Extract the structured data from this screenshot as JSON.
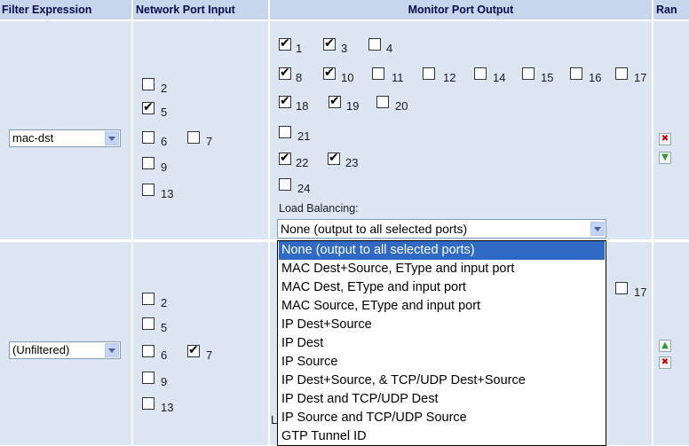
{
  "headers": {
    "filter": "Filter Expression",
    "input": "Network Port Input",
    "output": "Monitor Port Output",
    "rank": "Ran"
  },
  "row1": {
    "filter_value": "mac-dst",
    "input_ports": [
      {
        "label": "2",
        "checked": false
      },
      {
        "label": "5",
        "checked": true
      },
      {
        "label": "6",
        "checked": false
      },
      {
        "label": "7",
        "checked": false
      },
      {
        "label": "9",
        "checked": false
      },
      {
        "label": "13",
        "checked": false
      }
    ],
    "output_ports": [
      {
        "label": "1",
        "checked": true
      },
      {
        "label": "3",
        "checked": true
      },
      {
        "label": "4",
        "checked": false
      },
      {
        "label": "8",
        "checked": true
      },
      {
        "label": "10",
        "checked": true
      },
      {
        "label": "11",
        "checked": false
      },
      {
        "label": "12",
        "checked": false
      },
      {
        "label": "14",
        "checked": false
      },
      {
        "label": "15",
        "checked": false
      },
      {
        "label": "16",
        "checked": false
      },
      {
        "label": "17",
        "checked": false
      },
      {
        "label": "18",
        "checked": true
      },
      {
        "label": "19",
        "checked": true
      },
      {
        "label": "20",
        "checked": false
      },
      {
        "label": "21",
        "checked": false
      },
      {
        "label": "22",
        "checked": true
      },
      {
        "label": "23",
        "checked": true
      },
      {
        "label": "24",
        "checked": false
      }
    ],
    "load_balancing_label": "Load Balancing:",
    "load_balancing_value": "None (output to all selected ports)"
  },
  "row2": {
    "filter_value": "(Unfiltered)",
    "input_ports": [
      {
        "label": "2",
        "checked": false
      },
      {
        "label": "5",
        "checked": false
      },
      {
        "label": "6",
        "checked": false
      },
      {
        "label": "7",
        "checked": true
      },
      {
        "label": "9",
        "checked": false
      },
      {
        "label": "13",
        "checked": false
      }
    ],
    "output_ports_visible": [
      {
        "label": "17",
        "checked": false
      }
    ],
    "hidden_label_fragment": "L"
  },
  "dropdown_options": [
    "None (output to all selected ports)",
    "MAC Dest+Source, EType and input port",
    "MAC Dest, EType and input port",
    "MAC Source, EType and input port",
    "IP Dest+Source",
    "IP Dest",
    "IP Source",
    "IP Dest+Source, & TCP/UDP Dest+Source",
    "IP Dest and TCP/UDP Dest",
    "IP Source and TCP/UDP Source",
    "GTP Tunnel ID"
  ],
  "colors": {
    "header_bg": "#c6d6ec",
    "cell_bg": "#dce6f3",
    "selection": "#3169c6"
  },
  "icons": [
    "delete-icon",
    "move-down-icon",
    "move-up-icon",
    "dropdown-arrow-icon",
    "checkbox-icon"
  ]
}
